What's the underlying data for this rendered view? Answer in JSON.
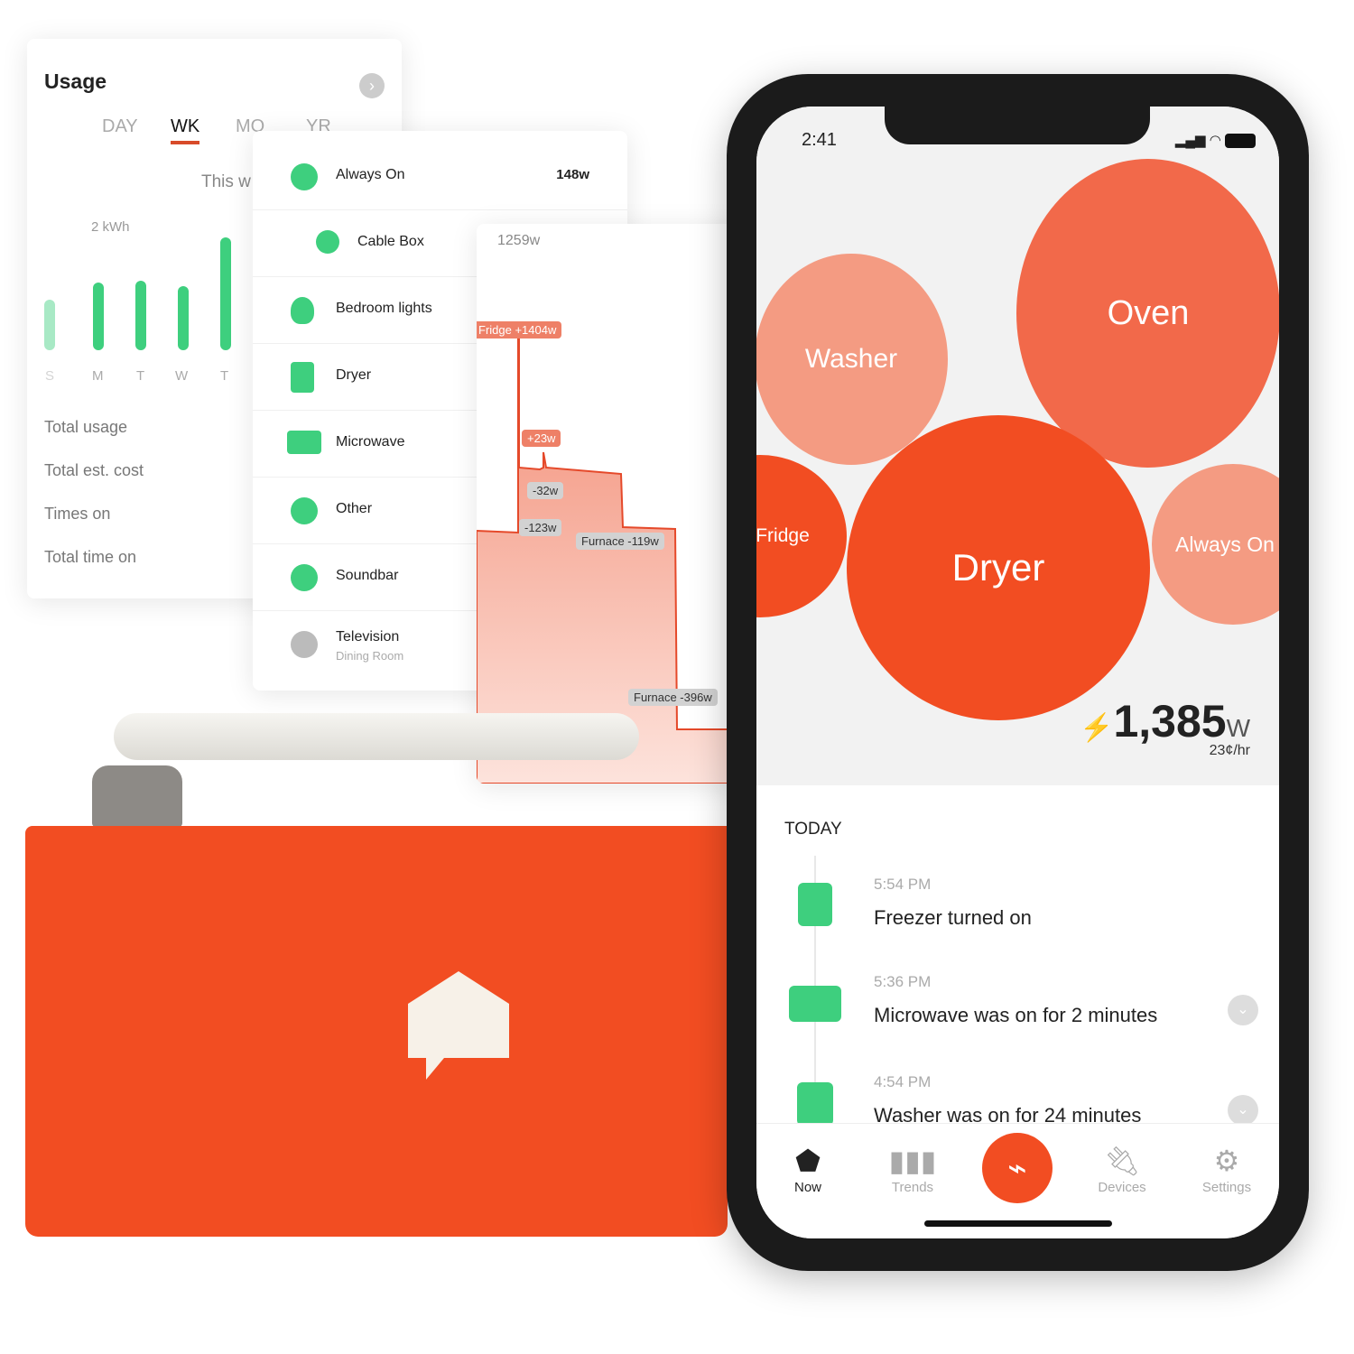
{
  "usage_card": {
    "title": "Usage",
    "tabs": [
      "DAY",
      "WK",
      "MO",
      "YR"
    ],
    "active_tab": "WK",
    "period_label": "This w",
    "y_label": "2 kWh",
    "days": [
      "S",
      "M",
      "T",
      "W",
      "T"
    ],
    "bar_levels": [
      0.45,
      0.6,
      0.62,
      0.57,
      1.0
    ],
    "stats": [
      "Total usage",
      "Total est. cost",
      "Times on",
      "Total time on"
    ]
  },
  "device_list": [
    {
      "name": "Always On",
      "watts": "148w",
      "icon": "refresh-icon"
    },
    {
      "name": "Cable Box",
      "icon": "outlet-icon"
    },
    {
      "name": "Bedroom lights",
      "icon": "lightbulb-icon"
    },
    {
      "name": "Dryer",
      "icon": "dryer-icon"
    },
    {
      "name": "Microwave",
      "icon": "microwave-icon"
    },
    {
      "name": "Other",
      "icon": "plug-icon"
    },
    {
      "name": "Soundbar",
      "icon": "outlet-icon"
    },
    {
      "name": "Television",
      "sub": "Dining Room",
      "icon": "outlet-icon"
    }
  ],
  "power_chart": {
    "max_label": "1259w",
    "events": [
      "Fridge +1404w",
      "+23w",
      "-32w",
      "-123w",
      "Furnace -119w",
      "Furnace -396w"
    ]
  },
  "phone": {
    "time": "2:41",
    "bubbles": [
      "Washer",
      "Oven",
      "Fridge",
      "Dryer",
      "Always On"
    ],
    "current_watts": "1,385",
    "watts_unit": "W",
    "rate": "23¢/hr",
    "today_label": "TODAY",
    "events": [
      {
        "time": "5:54 PM",
        "text": "Freezer turned on",
        "icon": "fridge-icon"
      },
      {
        "time": "5:36 PM",
        "text": "Microwave was on for 2 minutes",
        "icon": "microwave-icon"
      },
      {
        "time": "4:54 PM",
        "text": "Washer was on for 24 minutes",
        "icon": "washer-icon"
      }
    ],
    "nav": [
      "Now",
      "Trends",
      "Devices",
      "Settings"
    ],
    "active_nav": "Now"
  },
  "colors": {
    "accent": "#f24d22",
    "green": "#3ecf7e",
    "bubble_light": "#f49b82",
    "bubble_mid": "#f2694a"
  }
}
